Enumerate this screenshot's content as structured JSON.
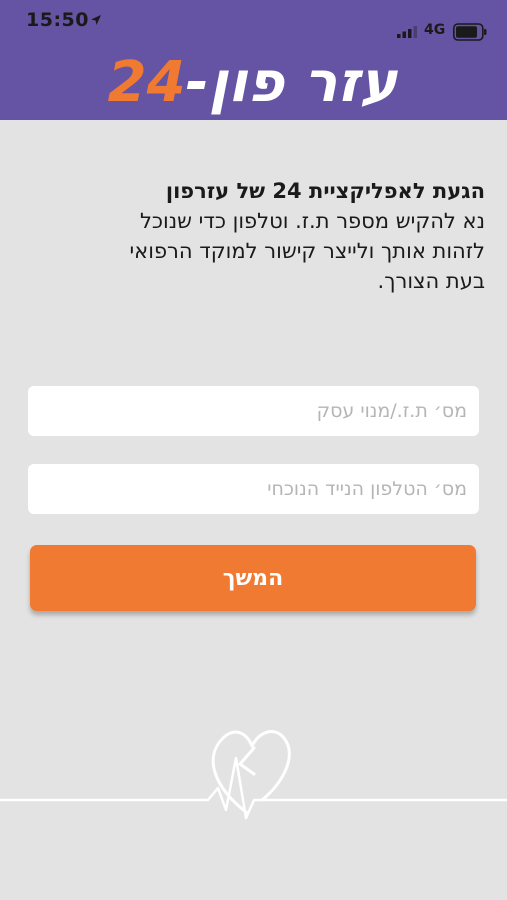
{
  "status_bar": {
    "time": "15:50",
    "network": "4G",
    "icons": [
      "location-arrow-icon",
      "signal-icon",
      "battery-icon"
    ]
  },
  "header": {
    "logo_text_he": "עזר פון-",
    "logo_text_num": "24",
    "background_color": "#6553a3",
    "accent_color": "#f07a31"
  },
  "intro": {
    "title": "הגעת לאפליקציית 24 של עזרפון",
    "body": "נא להקיש מספר ת.ז. וטלפון כדי שנוכל לזהות אותך ולייצר קישור למוקד הרפואי בעת הצורך."
  },
  "form": {
    "id_field": {
      "value": "",
      "placeholder": "מס׳ ת.ז./מנוי עסק"
    },
    "phone_field": {
      "value": "",
      "placeholder": "מס׳ הטלפון הנייד הנוכחי"
    },
    "continue_label": "המשך"
  },
  "decoration": {
    "icon": "heartbeat-heart-icon"
  }
}
